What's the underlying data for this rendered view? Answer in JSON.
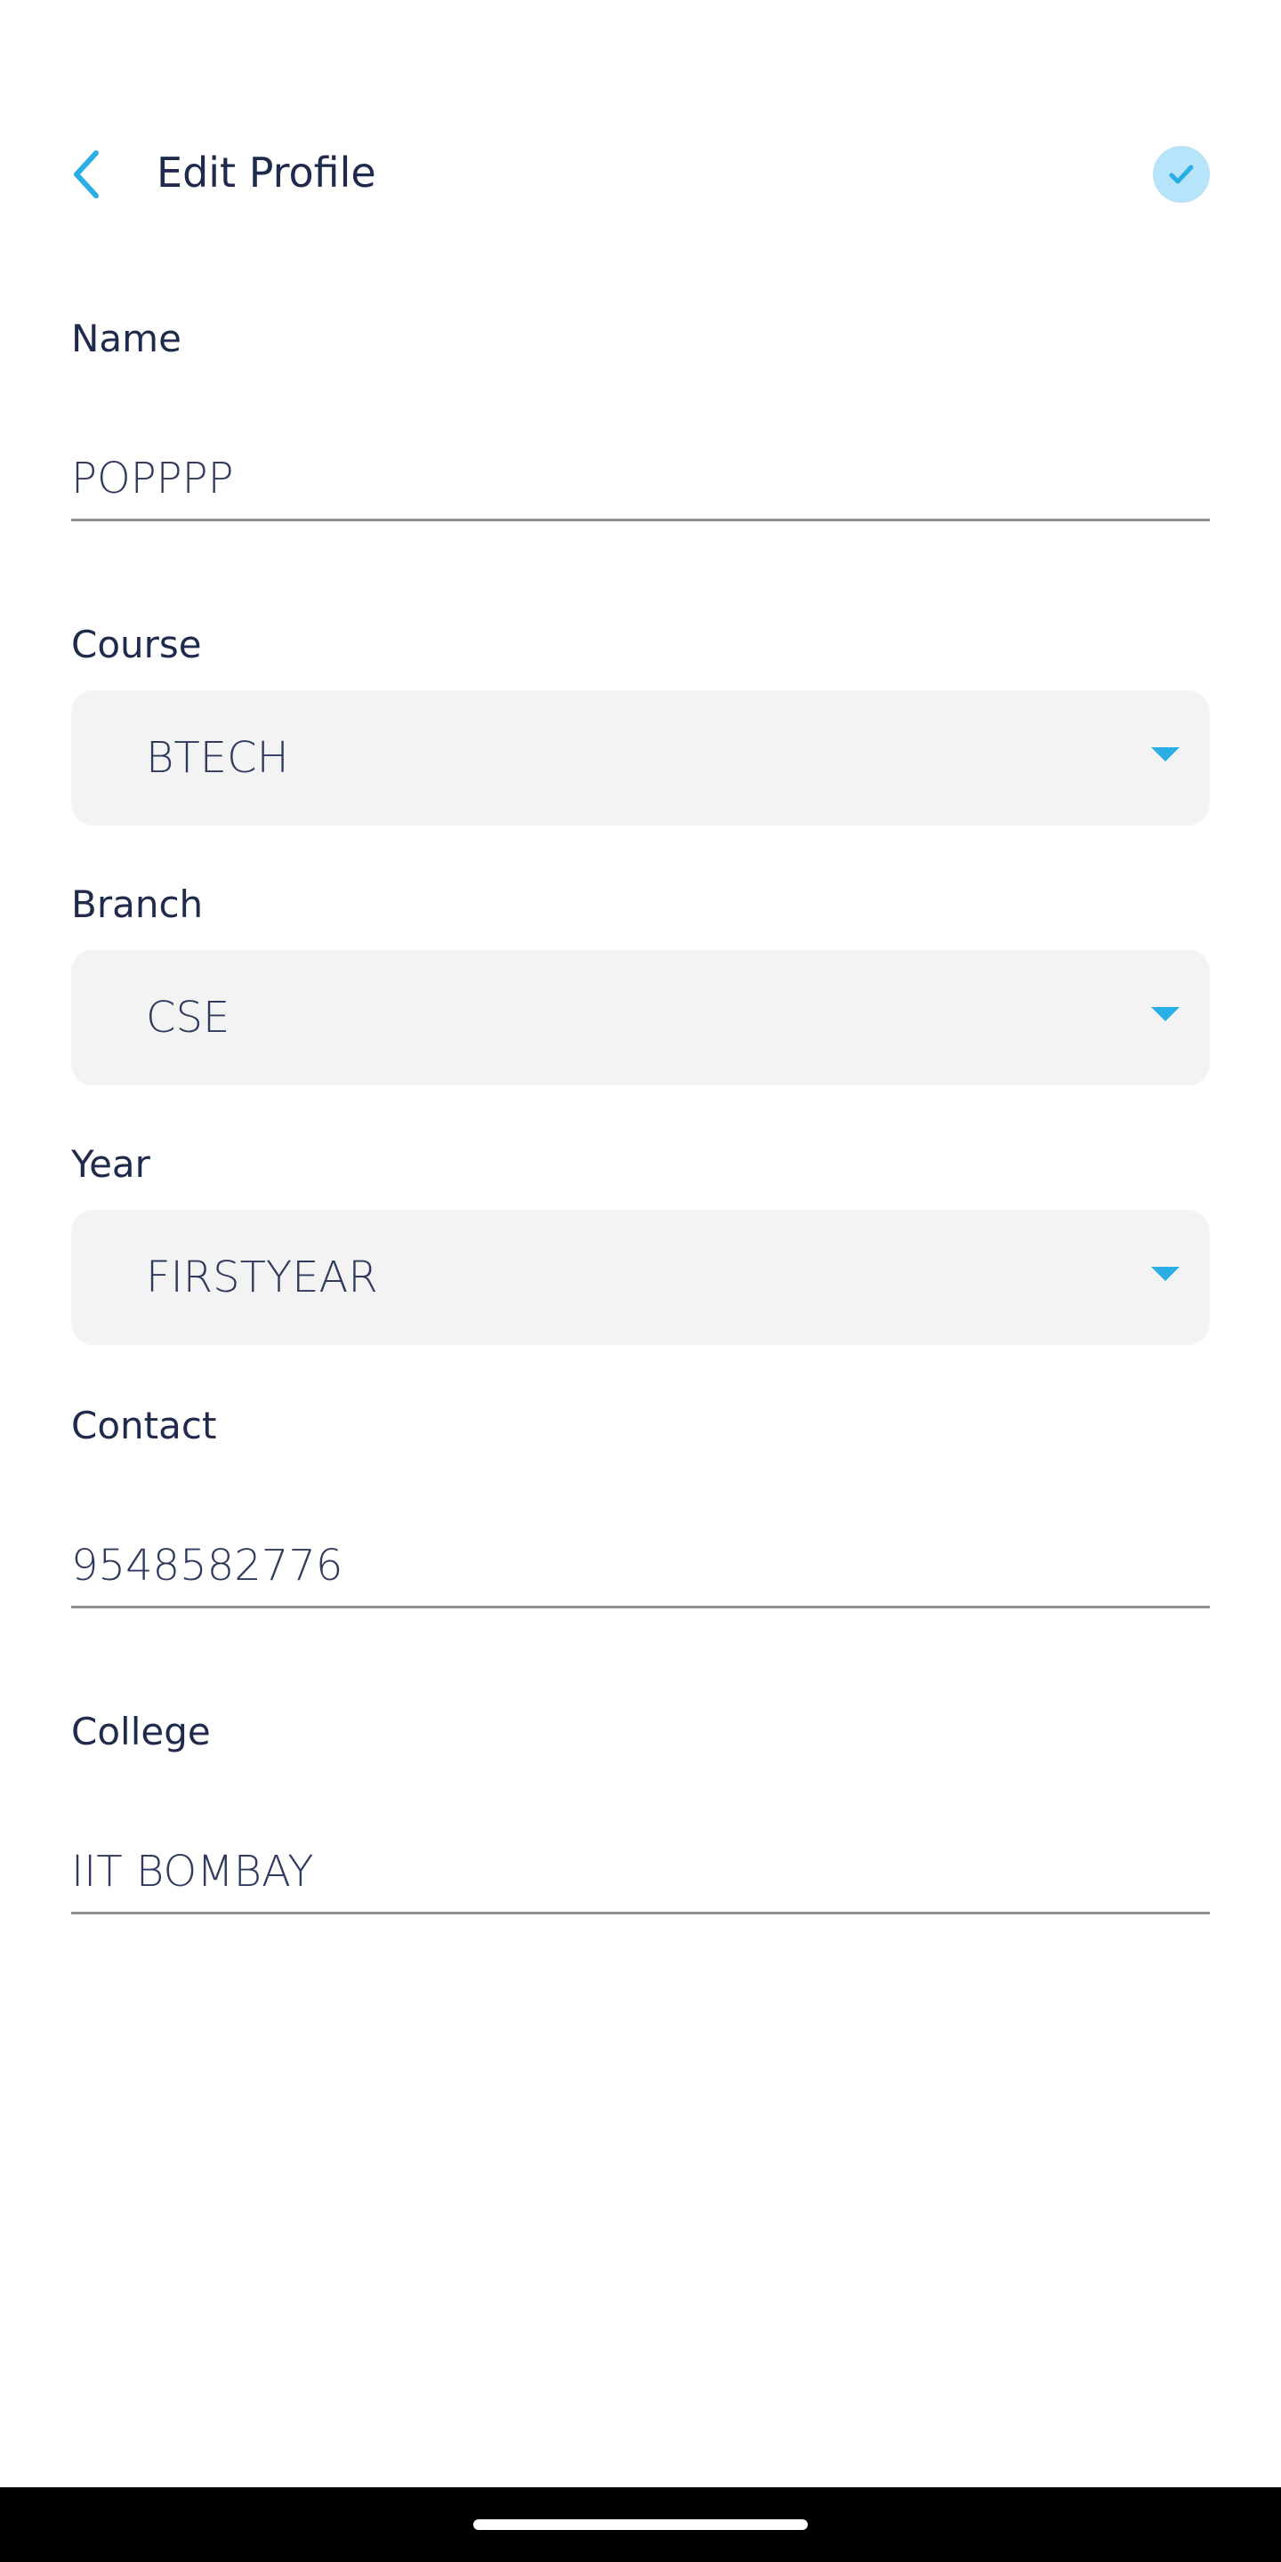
{
  "header": {
    "title": "Edit Profile",
    "back_icon": "chevron-left-icon",
    "save_icon": "check-icon"
  },
  "form": {
    "name": {
      "label": "Name",
      "value": "POPPPP"
    },
    "course": {
      "label": "Course",
      "value": "BTECH"
    },
    "branch": {
      "label": "Branch",
      "value": "CSE"
    },
    "year": {
      "label": "Year",
      "value": "FIRSTYEAR"
    },
    "contact": {
      "label": "Contact",
      "value": "9548582776"
    },
    "college": {
      "label": "College",
      "value": "IIT BOMBAY"
    }
  },
  "colors": {
    "accent": "#29aee6",
    "accent_light": "#b6e4fb",
    "text_primary": "#1f2a4d",
    "select_bg": "#f3f3f3",
    "underline": "#8e8e8e"
  }
}
